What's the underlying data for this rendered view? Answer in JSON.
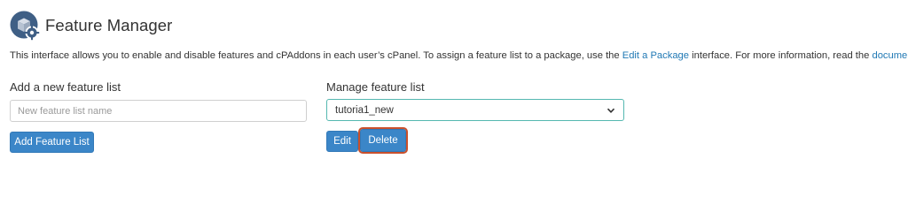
{
  "header": {
    "title": "Feature Manager",
    "icon": "feature-manager-icon"
  },
  "intro": {
    "text_before": "This interface allows you to enable and disable features and cPAddons in each user’s cPanel. To assign a feature list to a package, use the ",
    "link_edit_package": "Edit a Package",
    "text_middle": " interface. For more information, read the ",
    "link_documentation": "documentation",
    "text_after": "."
  },
  "add_section": {
    "label": "Add a new feature list",
    "input_placeholder": "New feature list name",
    "input_value": "",
    "button_label": "Add Feature List"
  },
  "manage_section": {
    "label": "Manage feature list",
    "selected_value": "tutoria1_new",
    "edit_label": "Edit",
    "delete_label": "Delete"
  },
  "colors": {
    "button": "#3b86c8",
    "link": "#1f78b4",
    "highlight": "#c9502c",
    "select_border": "#55b8b0"
  }
}
